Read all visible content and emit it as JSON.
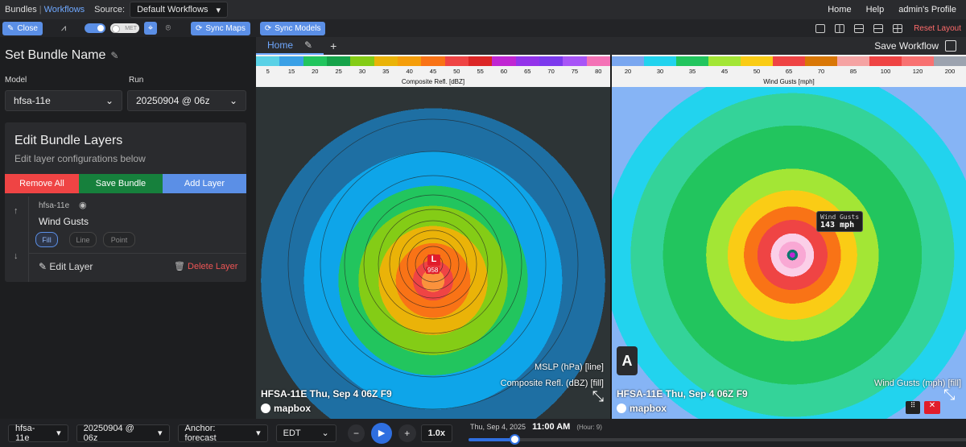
{
  "topbar": {
    "bundles": "Bundles",
    "workflows": "Workflows",
    "source_label": "Source:",
    "source_value": "Default Workflows",
    "home": "Home",
    "help": "Help",
    "profile": "admin's Profile"
  },
  "toolbar": {
    "close": "Close",
    "met": "MET",
    "sync_maps": "Sync Maps",
    "sync_models": "Sync Models",
    "reset_layout": "Reset Layout"
  },
  "sidebar": {
    "bundle_name": "Set Bundle Name",
    "model_label": "Model",
    "model_value": "hfsa-11e",
    "run_label": "Run",
    "run_value": "20250904 @ 06z",
    "edit_title": "Edit Bundle Layers",
    "edit_sub": "Edit layer configurations below",
    "remove_all": "Remove All",
    "save_bundle": "Save Bundle",
    "add_layer": "Add Layer",
    "layer": {
      "model": "hfsa-11e",
      "name": "Wind Gusts",
      "modes": [
        "Fill",
        "Line",
        "Point"
      ],
      "edit": "Edit Layer",
      "delete": "Delete Layer"
    }
  },
  "tabs": {
    "home": "Home",
    "save_workflow": "Save Workflow"
  },
  "map_left": {
    "colorbar_ticks": [
      "5",
      "15",
      "20",
      "25",
      "30",
      "35",
      "40",
      "45",
      "50",
      "55",
      "60",
      "65",
      "70",
      "75",
      "80"
    ],
    "colorbar_colors": [
      "#5ad1e6",
      "#3aa0e6",
      "#22c55e",
      "#16a34a",
      "#84cc16",
      "#eab308",
      "#f59e0b",
      "#f97316",
      "#ef4444",
      "#dc2626",
      "#c026d3",
      "#9333ea",
      "#7c3aed",
      "#a855f7",
      "#f472b6"
    ],
    "colorbar_label": "Composite Refl. [dBZ]",
    "legend_line": "MSLP (hPa) [line]",
    "legend_fill": "Composite Refl. (dBZ) [fill]",
    "title": "HFSA-11E Thu, Sep 4 06Z F9",
    "low_label": "L",
    "low_value": "958",
    "attribution": "mapbox"
  },
  "map_right": {
    "colorbar_ticks": [
      "20",
      "30",
      "35",
      "45",
      "50",
      "65",
      "70",
      "85",
      "100",
      "120",
      "200"
    ],
    "colorbar_colors": [
      "#7aa7f0",
      "#22d3ee",
      "#22c55e",
      "#a3e635",
      "#facc15",
      "#ef4444",
      "#d97706",
      "#f5a3a3",
      "#ef4444",
      "#f87171",
      "#9ca3af"
    ],
    "colorbar_label": "Wind Gusts [mph]",
    "tooltip_title": "Wind Gusts",
    "tooltip_value": "143 mph",
    "legend_fill": "Wind Gusts (mph) [fill]",
    "title": "HFSA-11E Thu, Sep 4 06Z F9",
    "attribution": "mapbox",
    "panel_letter": "A"
  },
  "bottom": {
    "model": "hfsa-11e",
    "run": "20250904 @ 06z",
    "anchor": "Anchor: forecast",
    "tz": "EDT",
    "speed": "1.0x",
    "date": "Thu, Sep 4, 2025",
    "time": "11:00 AM",
    "hour": "(Hour: 9)",
    "progress": 0.09
  }
}
